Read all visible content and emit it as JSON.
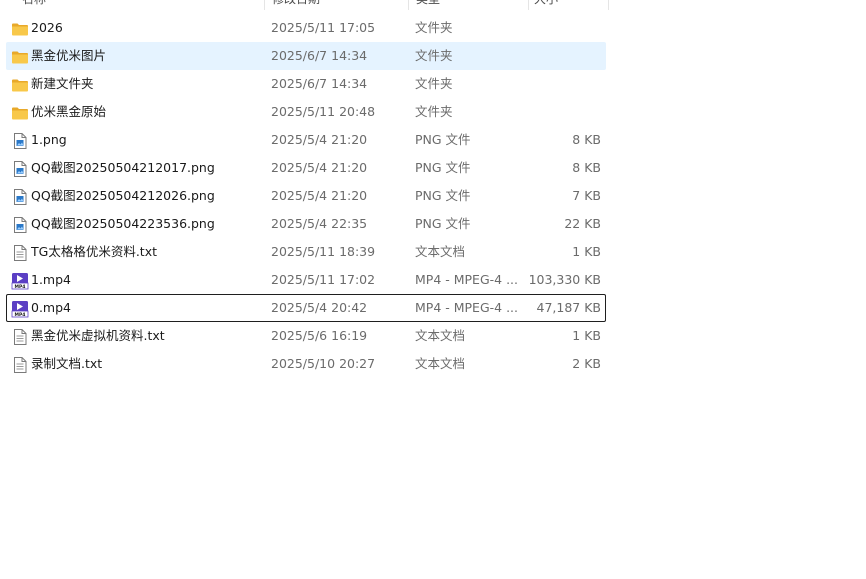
{
  "columns": {
    "name": "名称",
    "date": "修改日期",
    "type": "类型",
    "size": "大小"
  },
  "files": [
    {
      "name": "2026",
      "date": "2025/5/11 17:05",
      "type": "文件夹",
      "size": "",
      "icon": "folder-icon"
    },
    {
      "name": "黑金优米图片",
      "date": "2025/6/7 14:34",
      "type": "文件夹",
      "size": "",
      "icon": "folder-icon"
    },
    {
      "name": "新建文件夹",
      "date": "2025/6/7 14:34",
      "type": "文件夹",
      "size": "",
      "icon": "folder-icon"
    },
    {
      "name": "优米黑金原始",
      "date": "2025/5/11 20:48",
      "type": "文件夹",
      "size": "",
      "icon": "folder-icon"
    },
    {
      "name": "1.png",
      "date": "2025/5/4 21:20",
      "type": "PNG 文件",
      "size": "8 KB",
      "icon": "image-file-icon"
    },
    {
      "name": "QQ截图20250504212017.png",
      "date": "2025/5/4 21:20",
      "type": "PNG 文件",
      "size": "8 KB",
      "icon": "image-file-icon"
    },
    {
      "name": "QQ截图20250504212026.png",
      "date": "2025/5/4 21:20",
      "type": "PNG 文件",
      "size": "7 KB",
      "icon": "image-file-icon"
    },
    {
      "name": "QQ截图20250504223536.png",
      "date": "2025/5/4 22:35",
      "type": "PNG 文件",
      "size": "22 KB",
      "icon": "image-file-icon"
    },
    {
      "name": "TG太格格优米资料.txt",
      "date": "2025/5/11 18:39",
      "type": "文本文档",
      "size": "1 KB",
      "icon": "text-file-icon"
    },
    {
      "name": "1.mp4",
      "date": "2025/5/11 17:02",
      "type": "MP4 - MPEG-4 ...",
      "size": "103,330 KB",
      "icon": "video-file-icon"
    },
    {
      "name": "0.mp4",
      "date": "2025/5/4 20:42",
      "type": "MP4 - MPEG-4 ...",
      "size": "47,187 KB",
      "icon": "video-file-icon"
    },
    {
      "name": "黑金优米虚拟机资料.txt",
      "date": "2025/5/6 16:19",
      "type": "文本文档",
      "size": "1 KB",
      "icon": "text-file-icon"
    },
    {
      "name": "录制文档.txt",
      "date": "2025/5/10 20:27",
      "type": "文本文档",
      "size": "2 KB",
      "icon": "text-file-icon"
    }
  ],
  "state": {
    "hovered_row": "黑金优米图片",
    "focused_row": "0.mp4"
  },
  "colors": {
    "hover_bg": "#e5f3ff",
    "focus_border": "#1f1f1f",
    "folder": "#f8c84a",
    "video_badge": "#5b3fc4"
  }
}
